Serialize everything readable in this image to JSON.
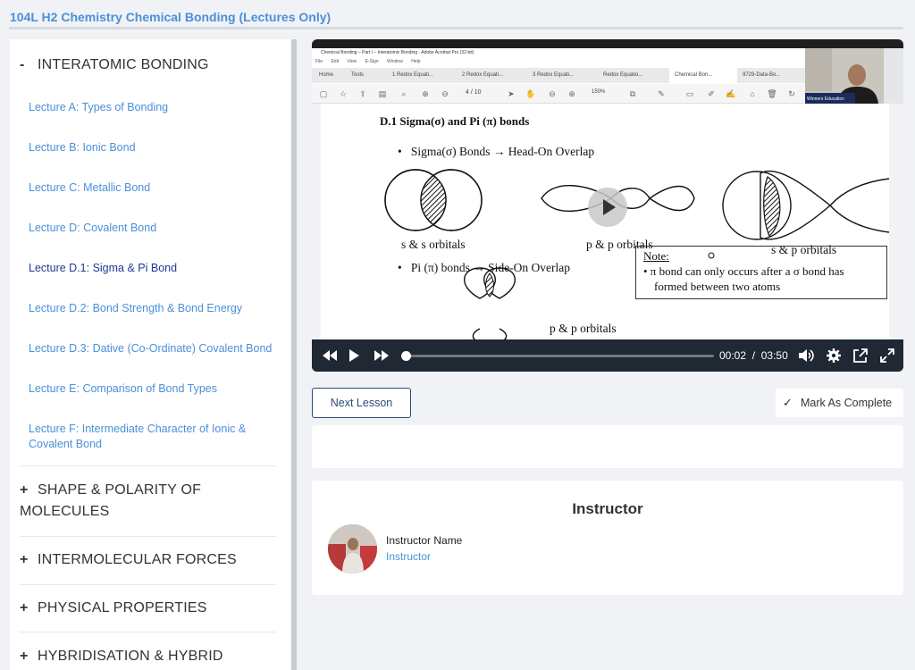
{
  "course": {
    "title": "104L H2 Chemistry Chemical Bonding (Lectures Only)"
  },
  "sidebar": {
    "sections": [
      {
        "symbol": "-",
        "label": "INTERATOMIC BONDING",
        "expanded": true
      },
      {
        "symbol": "+",
        "label": "SHAPE & POLARITY OF MOLECULES",
        "expanded": false
      },
      {
        "symbol": "+",
        "label": "INTERMOLECULAR FORCES",
        "expanded": false
      },
      {
        "symbol": "+",
        "label": "PHYSICAL PROPERTIES",
        "expanded": false
      },
      {
        "symbol": "+",
        "label": "HYBRIDISATION & HYBRID",
        "expanded": false
      }
    ],
    "lessons": [
      {
        "label": "Lecture A: Types of Bonding",
        "active": false
      },
      {
        "label": "Lecture B: Ionic Bond",
        "active": false
      },
      {
        "label": "Lecture C: Metallic Bond",
        "active": false
      },
      {
        "label": "Lecture D: Covalent Bond",
        "active": false
      },
      {
        "label": "Lecture D.1: Sigma & Pi Bond",
        "active": true
      },
      {
        "label": "Lecture D.2: Bond Strength & Bond Energy",
        "active": false
      },
      {
        "label": "Lecture D.3: Dative (Co-Ordinate) Covalent Bond",
        "active": false
      },
      {
        "label": "Lecture E: Comparison of Bond Types",
        "active": false
      },
      {
        "label": "Lecture F: Intermediate Character of Ionic & Covalent Bond",
        "active": false
      }
    ]
  },
  "video": {
    "screen": {
      "window_title": "Chemical Bonding – Part I – Interatomic Bonding - Adobe Acrobat Pro (32-bit)",
      "menu": [
        "File",
        "Edit",
        "View",
        "E-Sign",
        "Window",
        "Help"
      ],
      "tabs": [
        "Home",
        "Tools",
        "1 Redox Equati...",
        "2 Redox Equati...",
        "3 Redox Equati...",
        "Redox Equatio...",
        "Chemical Bon...",
        "9729-Data-Bo..."
      ],
      "active_tab": "Chemical Bon...",
      "page_current": "4",
      "page_total": "/ 10",
      "zoom": "150%",
      "webcam_label": "Winners Education",
      "doc": {
        "heading": "D.1 Sigma(σ) and Pi (π) bonds",
        "bullet1": "Sigma(σ) Bonds → Head-On Overlap",
        "caption_ss": "s & s orbitals",
        "caption_pp": "p & p orbitals",
        "caption_sp": "s & p orbitals",
        "bullet2": "Pi (π) bonds → Side-On Overlap",
        "caption_pp2": "p & p orbitals",
        "note_title": "Note:",
        "note_line1": "• π bond can only occurs after a  σ  bond has",
        "note_line2": "formed between two atoms"
      }
    },
    "current_time": "00:02",
    "time_separator": "/",
    "duration": "03:50",
    "progress": 0.01
  },
  "actions": {
    "next_label": "Next Lesson",
    "complete_label": "Mark As Complete"
  },
  "instructor": {
    "heading": "Instructor",
    "name": "Instructor Name",
    "role": "Instructor"
  }
}
